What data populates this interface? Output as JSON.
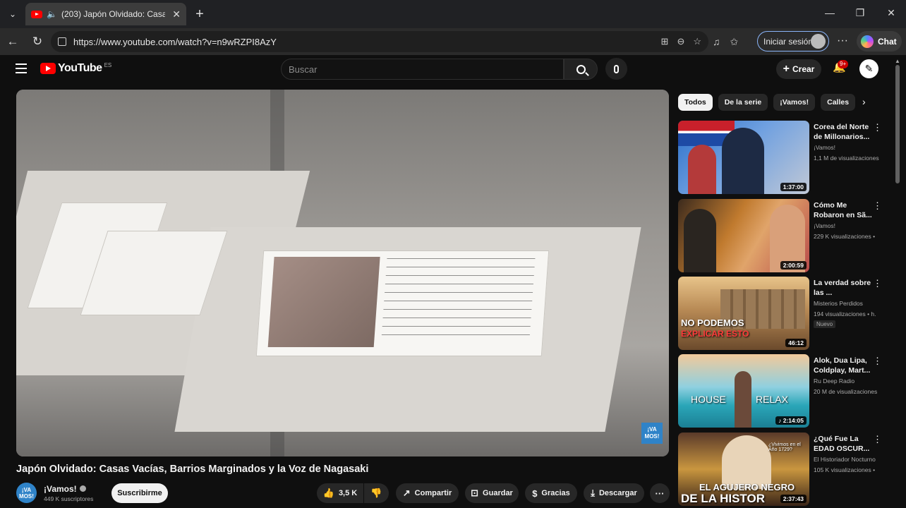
{
  "browser": {
    "tab_title": "(203) Japón Olvidado: Casas V",
    "url": "https://www.youtube.com/watch?v=n9wRZPI8AzY",
    "signin_label": "Iniciar sesión",
    "chat_label": "Chat"
  },
  "header": {
    "logo_text": "YouTube",
    "logo_country": "ES",
    "search_placeholder": "Buscar",
    "create_label": "Crear",
    "notif_badge": "9+"
  },
  "video": {
    "title": "Japón Olvidado: Casas Vacías, Barrios Marginados y la Voz de Nagasaki",
    "watermark": "¡VA MOS!",
    "channel_name": "¡Vamos!",
    "channel_avatar_text": "¡VA MOS!",
    "subscribers": "449 K suscriptores",
    "subscribe_label": "Suscribirme",
    "likes": "3,5 K",
    "share_label": "Compartir",
    "save_label": "Guardar",
    "thanks_label": "Gracias",
    "download_label": "Descargar"
  },
  "chips": [
    "Todos",
    "De la serie",
    "¡Vamos!",
    "Calles"
  ],
  "recommendations": [
    {
      "title": "Corea del Norte de Millonarios...",
      "channel": "¡Vamos!",
      "views": "1,1 M de visualizaciones",
      "duration": "1:37:00",
      "badge": ""
    },
    {
      "title": "Cómo Me Robaron en Sã...",
      "channel": "¡Vamos!",
      "views": "229 K visualizaciones •",
      "duration": "2:00:59",
      "badge": ""
    },
    {
      "title": "La verdad sobre las ...",
      "channel": "Misterios Perdidos",
      "views": "194 visualizaciones • h.",
      "duration": "46:12",
      "badge": "Nuevo",
      "thumb_text": "NO PODEMOS",
      "thumb_text2": "EXPLICAR ESTO"
    },
    {
      "title": "Alok, Dua Lipa, Coldplay, Mart...",
      "channel": "Ru Deep Radio",
      "views": "20 M de visualizaciones",
      "duration": "2:14:05",
      "badge": "",
      "thumb_text": "HOUSE",
      "thumb_text2": "RELAX"
    },
    {
      "title": "¿Qué Fue La EDAD OSCUR...",
      "channel": "El Historiador Nocturno",
      "views": "105 K visualizaciones •",
      "duration": "2:37:43",
      "badge": "",
      "thumb_text": "EL AGUJERO NEGRO",
      "thumb_text2": "DE LA HISTOR",
      "thumb_text3": "¿Vivimos en el Año 1729?"
    }
  ]
}
